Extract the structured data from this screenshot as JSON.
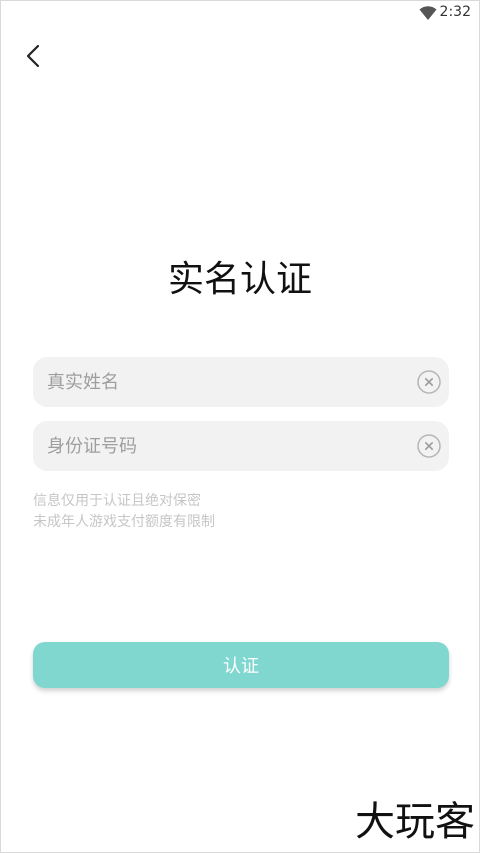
{
  "status_bar": {
    "time": "2:32",
    "wifi_icon": "wifi-icon"
  },
  "header": {
    "back_icon": "back-icon",
    "title": "实名认证"
  },
  "form": {
    "name_placeholder": "真实姓名",
    "name_value": "",
    "id_placeholder": "身份证号码",
    "id_value": "",
    "clear_icon": "clear-icon"
  },
  "notice": {
    "line1": "信息仅用于认证且绝对保密",
    "line2": "未成年人游戏支付额度有限制"
  },
  "actions": {
    "verify_label": "认证"
  },
  "watermark": {
    "text": "大玩客"
  },
  "colors": {
    "accent": "#80d7d0",
    "input_bg": "#f2f2f2",
    "notice_text": "#c6c6c6"
  }
}
